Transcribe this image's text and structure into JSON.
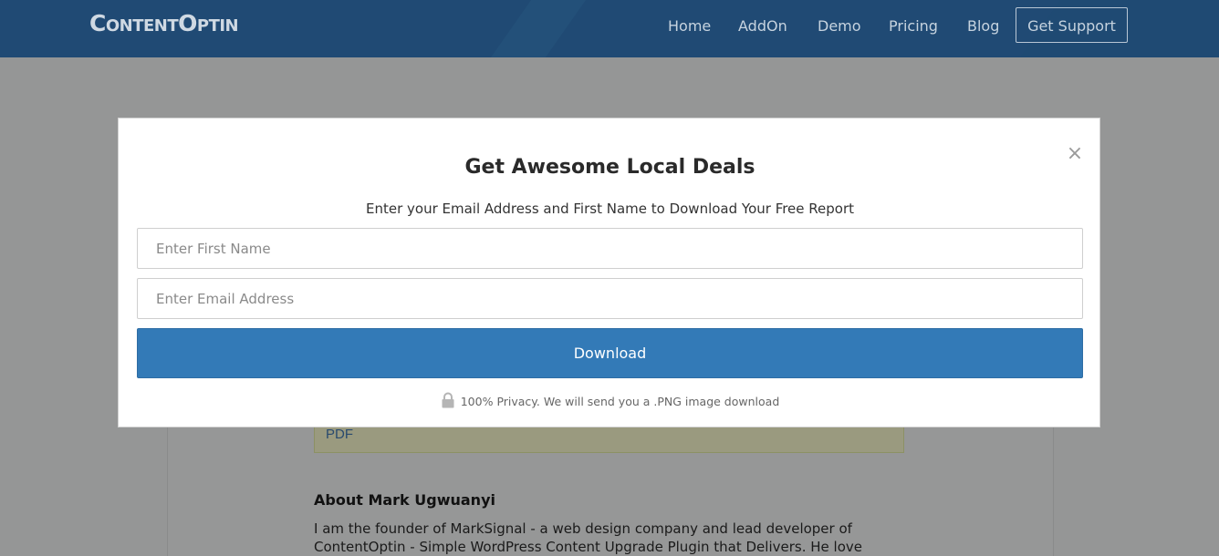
{
  "header": {
    "logo": "ContentOptin",
    "nav": {
      "home": "Home",
      "addon": "AddOn",
      "demo": "Demo",
      "pricing": "Pricing",
      "blog": "Blog",
      "support": "Get Support"
    }
  },
  "page": {
    "note_text": "PDF",
    "about_title": "About Mark Ugwuanyi",
    "about_text": "I am the founder of MarkSignal - a web design company and lead developer of ContentOptin - Simple WordPress Content Upgrade Plugin that Delivers. He love"
  },
  "modal": {
    "close_glyph": "×",
    "title": "Get Awesome Local Deals",
    "subtitle": "Enter your Email Address and First Name to Download Your Free Report",
    "first_name_placeholder": "Enter First Name",
    "email_placeholder": "Enter Email Address",
    "first_name_value": "",
    "email_value": "",
    "download_label": "Download",
    "privacy_text": "100% Privacy. We will send you a .PNG image download",
    "privacy_icon": "lock-icon"
  },
  "colors": {
    "header_bg": "#204a74",
    "overlay_bg": "#959696",
    "button_bg": "#337ab7",
    "modal_bg": "#ffffff"
  }
}
